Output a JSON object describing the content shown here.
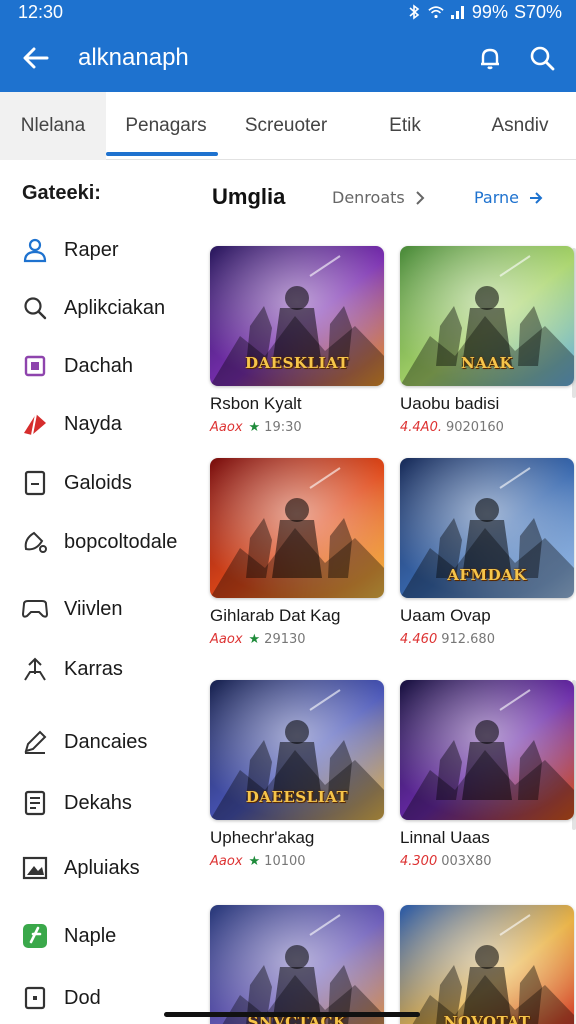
{
  "status_bar": {
    "time": "12:30",
    "battery": "99%",
    "signal_text": "S70%"
  },
  "app_bar": {
    "title": "alknanaph"
  },
  "tabs": [
    {
      "label": "Nlelana"
    },
    {
      "label": "Penagars"
    },
    {
      "label": "Screuoter"
    },
    {
      "label": "Etik"
    },
    {
      "label": "Asndiv"
    }
  ],
  "sidebar": {
    "heading": "Gateeki:",
    "items": [
      {
        "label": "Raper",
        "icon": "person-icon",
        "color": "#1e72cf"
      },
      {
        "label": "Aplikciakan",
        "icon": "search-icon",
        "color": "#333333"
      },
      {
        "label": "Dachah",
        "icon": "square-icon",
        "color": "#8e44ad"
      },
      {
        "label": "Nayda",
        "icon": "triangle-icon",
        "color": "#d62d2d"
      },
      {
        "label": "Galoids",
        "icon": "box-icon",
        "color": "#333333"
      },
      {
        "label": "bopcoltodale",
        "icon": "edit-icon",
        "color": "#333333"
      },
      {
        "label": "Viivlen",
        "icon": "gamepad-icon",
        "color": "#333333"
      },
      {
        "label": "Karras",
        "icon": "share-icon",
        "color": "#333333"
      },
      {
        "label": "Dancaies",
        "icon": "pencil-icon",
        "color": "#333333"
      },
      {
        "label": "Dekahs",
        "icon": "document-icon",
        "color": "#333333"
      },
      {
        "label": "Apluiaks",
        "icon": "image-icon",
        "color": "#333333"
      },
      {
        "label": "Naple",
        "icon": "green-app-icon",
        "color": "#3aa84a"
      },
      {
        "label": "Dod",
        "icon": "dot-box-icon",
        "color": "#333333"
      }
    ]
  },
  "main": {
    "section_title": "Umglia",
    "sort_label": "Denroats",
    "filter_label": "Parne",
    "cards": [
      {
        "title": "Rsbon Kyalt",
        "tag": "Aaox",
        "star": "★",
        "num": "19:30",
        "palette": [
          "#2b1a5e",
          "#7a2fb0",
          "#f09a2a"
        ],
        "banner": "DAESKLIAT"
      },
      {
        "title": "Uaobu badisi",
        "tag": "4.4A0.",
        "star": "",
        "num": "9020160",
        "palette": [
          "#4a8a3a",
          "#a8d46a",
          "#6fb6e8"
        ],
        "banner": "NAAK"
      },
      {
        "title": "Gihlarab Dat Kag",
        "tag": "Aaox",
        "star": "★",
        "num": "29130",
        "palette": [
          "#7a1010",
          "#e04a1a",
          "#f7c34a"
        ],
        "banner": ""
      },
      {
        "title": "Uaam Ovap",
        "tag": "4.460",
        "star": "",
        "num": "912.680",
        "palette": [
          "#1a2d5a",
          "#3a6ab0",
          "#a5c8f0"
        ],
        "banner": "AFMDAK"
      },
      {
        "title": "Uphechr'akag",
        "tag": "Aaox",
        "star": "★",
        "num": "10100",
        "palette": [
          "#1a2450",
          "#4a56b8",
          "#f0c050"
        ],
        "banner": "DAEESLIAT"
      },
      {
        "title": "Linnal Uaas",
        "tag": "4.300",
        "star": "",
        "num": "003X80",
        "palette": [
          "#1a1440",
          "#6a2aa8",
          "#e05a1a"
        ],
        "banner": ""
      },
      {
        "title": "",
        "tag": "",
        "star": "",
        "num": "",
        "palette": [
          "#2a3a7a",
          "#6a5ab8",
          "#f0a040"
        ],
        "banner": "SNVCTACK"
      },
      {
        "title": "",
        "tag": "",
        "star": "",
        "num": "",
        "palette": [
          "#2a5aa8",
          "#e8b040",
          "#d02a2a"
        ],
        "banner": "NOVOTAT"
      }
    ]
  }
}
